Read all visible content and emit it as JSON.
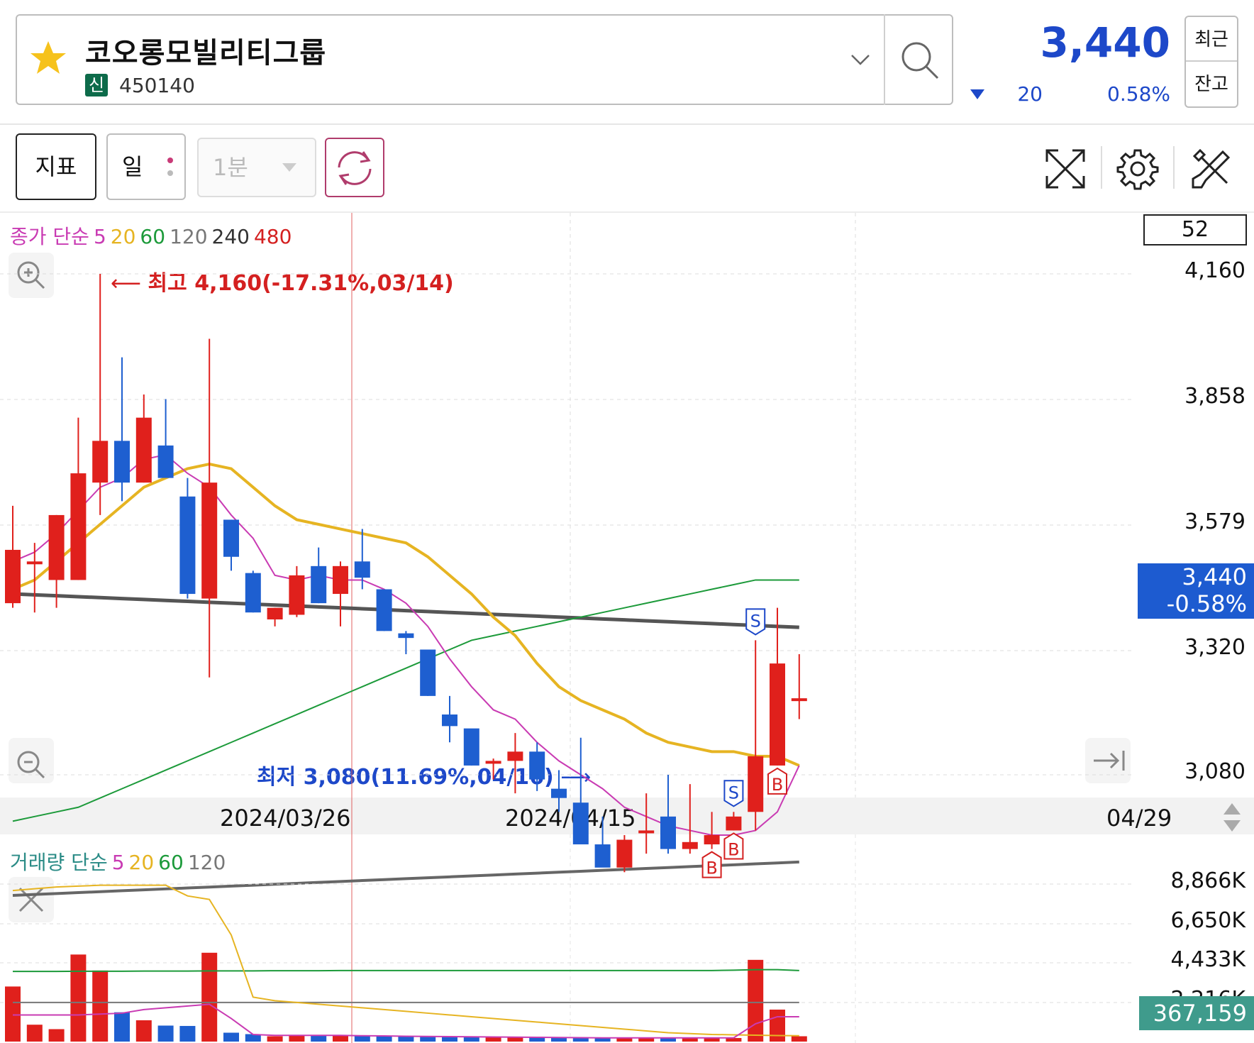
{
  "stock": {
    "name": "코오롱모빌리티그룹",
    "badge": "신",
    "code": "450140",
    "price": "3,440",
    "change": "20",
    "change_pct": "0.58%",
    "recent_label": "최근",
    "balance_label": "잔고"
  },
  "toolbar": {
    "indicator_label": "지표",
    "period_label": "일",
    "interval_label": "1분"
  },
  "price_chart": {
    "legend": {
      "prefix": "종가 단순",
      "ma5": "5",
      "ma20": "20",
      "ma60": "60",
      "ma120": "120",
      "ma240": "240",
      "ma480": "480"
    },
    "count_box": "52",
    "y_ticks": [
      "4,160",
      "3,858",
      "3,579",
      "3,320",
      "3,080"
    ],
    "current_price": "3,440",
    "current_pct": "-0.58%",
    "high_annotation": "최고 4,160(-17.31%,03/14)",
    "low_annotation": "최저 3,080(11.69%,04/16)",
    "x_ticks": [
      "2024/03/26",
      "2024/04/15",
      "04/29"
    ]
  },
  "volume_chart": {
    "legend": {
      "prefix": "거래량 단순",
      "ma5": "5",
      "ma20": "20",
      "ma60": "60",
      "ma120": "120"
    },
    "y_ticks": [
      "8,866K",
      "6,650K",
      "4,433K",
      "2,216K"
    ],
    "current_volume": "367,159"
  },
  "colors": {
    "up": "#e0201c",
    "down": "#1e5fd0",
    "ma5": "#c93bb3",
    "ma20": "#e6b422",
    "ma60": "#1c9a3a",
    "ma120": "#666666",
    "accent": "#1d48c9"
  },
  "chart_data": {
    "type": "candlestick",
    "candles": [
      {
        "o": 3450,
        "h": 3660,
        "l": 3440,
        "c": 3565
      },
      {
        "o": 3540,
        "h": 3580,
        "l": 3430,
        "c": 3540
      },
      {
        "o": 3500,
        "h": 3640,
        "l": 3440,
        "c": 3640
      },
      {
        "o": 3500,
        "h": 3850,
        "l": 3500,
        "c": 3730
      },
      {
        "o": 3710,
        "h": 4160,
        "l": 3640,
        "c": 3800
      },
      {
        "o": 3800,
        "h": 3980,
        "l": 3670,
        "c": 3710
      },
      {
        "o": 3710,
        "h": 3900,
        "l": 3710,
        "c": 3850
      },
      {
        "o": 3790,
        "h": 3890,
        "l": 3740,
        "c": 3720
      },
      {
        "o": 3680,
        "h": 3720,
        "l": 3460,
        "c": 3470
      },
      {
        "o": 3460,
        "h": 4020,
        "l": 3290,
        "c": 3710
      },
      {
        "o": 3630,
        "h": 3630,
        "l": 3520,
        "c": 3550
      },
      {
        "o": 3515,
        "h": 3520,
        "l": 3430,
        "c": 3430
      },
      {
        "o": 3415,
        "h": 3440,
        "l": 3400,
        "c": 3440
      },
      {
        "o": 3425,
        "h": 3530,
        "l": 3420,
        "c": 3510
      },
      {
        "o": 3530,
        "h": 3570,
        "l": 3450,
        "c": 3450
      },
      {
        "o": 3470,
        "h": 3540,
        "l": 3400,
        "c": 3530
      },
      {
        "o": 3540,
        "h": 3610,
        "l": 3480,
        "c": 3505
      },
      {
        "o": 3480,
        "h": 3480,
        "l": 3390,
        "c": 3390
      },
      {
        "o": 3385,
        "h": 3390,
        "l": 3340,
        "c": 3375
      },
      {
        "o": 3350,
        "h": 3350,
        "l": 3250,
        "c": 3250
      },
      {
        "o": 3210,
        "h": 3250,
        "l": 3150,
        "c": 3185
      },
      {
        "o": 3180,
        "h": 3175,
        "l": 3100,
        "c": 3100
      },
      {
        "o": 3110,
        "h": 3115,
        "l": 3070,
        "c": 3110
      },
      {
        "o": 3110,
        "h": 3170,
        "l": 3040,
        "c": 3130
      },
      {
        "o": 3130,
        "h": 3150,
        "l": 3045,
        "c": 3070
      },
      {
        "o": 3050,
        "h": 3090,
        "l": 3000,
        "c": 3030
      },
      {
        "o": 3020,
        "h": 3160,
        "l": 2980,
        "c": 2930
      },
      {
        "o": 2930,
        "h": 2990,
        "l": 2890,
        "c": 2880
      },
      {
        "o": 2880,
        "h": 2950,
        "l": 2870,
        "c": 2940
      },
      {
        "o": 2960,
        "h": 3040,
        "l": 2910,
        "c": 2960
      },
      {
        "o": 2990,
        "h": 3080,
        "l": 2910,
        "c": 2920
      },
      {
        "o": 2920,
        "h": 3060,
        "l": 2910,
        "c": 2935
      },
      {
        "o": 2930,
        "h": 3000,
        "l": 2920,
        "c": 2950
      },
      {
        "o": 2960,
        "h": 3000,
        "l": 2960,
        "c": 2990
      },
      {
        "o": 3000,
        "h": 3370,
        "l": 2960,
        "c": 3120
      },
      {
        "o": 3100,
        "h": 3440,
        "l": 3100,
        "c": 3320
      },
      {
        "o": 3245,
        "h": 3340,
        "l": 3200,
        "c": 3245
      }
    ],
    "ma_lines": {
      "ma5": [
        3540,
        3560,
        3600,
        3650,
        3700,
        3720,
        3760,
        3770,
        3730,
        3700,
        3640,
        3590,
        3510,
        3500,
        3510,
        3500,
        3500,
        3480,
        3450,
        3400,
        3330,
        3270,
        3220,
        3200,
        3150,
        3110,
        3080,
        3050,
        3010,
        2990,
        2970,
        2960,
        2950,
        2950,
        2960,
        3000,
        3100
      ],
      "ma20": [
        3480,
        3500,
        3540,
        3580,
        3620,
        3660,
        3700,
        3720,
        3740,
        3750,
        3740,
        3700,
        3660,
        3630,
        3620,
        3610,
        3600,
        3590,
        3580,
        3550,
        3510,
        3470,
        3420,
        3380,
        3320,
        3270,
        3240,
        3220,
        3200,
        3170,
        3150,
        3140,
        3130,
        3130,
        3120,
        3120,
        3100
      ],
      "ma60": [
        2980,
        2990,
        3000,
        3010,
        3030,
        3050,
        3070,
        3090,
        3110,
        3130,
        3150,
        3170,
        3190,
        3210,
        3230,
        3250,
        3270,
        3290,
        3310,
        3330,
        3350,
        3370,
        3380,
        3390,
        3400,
        3410,
        3420,
        3430,
        3440,
        3450,
        3460,
        3470,
        3480,
        3490,
        3500,
        3500,
        3500
      ],
      "ma120": [
        3470,
        3468,
        3466,
        3464,
        3462,
        3460,
        3458,
        3456,
        3454,
        3452,
        3450,
        3448,
        3446,
        3444,
        3442,
        3440,
        3438,
        3436,
        3434,
        3432,
        3430,
        3428,
        3426,
        3424,
        3422,
        3420,
        3418,
        3416,
        3414,
        3412,
        3410,
        3408,
        3406,
        3404,
        3402,
        3400,
        3398
      ],
      "ma240": [
        2820,
        2822,
        2824,
        2826,
        2828,
        2830,
        2832,
        2834,
        2836,
        2838,
        2840,
        2842,
        2844,
        2846,
        2848,
        2850,
        2852,
        2854,
        2856,
        2858,
        2860,
        2862,
        2864,
        2866,
        2868,
        2870,
        2872,
        2874,
        2876,
        2878,
        2880,
        2882,
        2884,
        2886,
        2888,
        2890,
        2892
      ]
    },
    "volume": [
      3100,
      950,
      700,
      4900,
      4000,
      1650,
      1200,
      900,
      880,
      5000,
      500,
      420,
      300,
      350,
      380,
      320,
      310,
      300,
      300,
      280,
      260,
      260,
      240,
      250,
      230,
      220,
      210,
      200,
      210,
      220,
      200,
      210,
      200,
      200,
      4600,
      1800,
      300
    ],
    "volume_ma": {
      "ma5": [
        1500,
        1500,
        1500,
        1500,
        1550,
        1600,
        1800,
        1900,
        2000,
        2100,
        1300,
        400,
        350,
        350,
        350,
        350,
        330,
        320,
        300,
        290,
        280,
        270,
        260,
        250,
        240,
        230,
        220,
        210,
        210,
        210,
        210,
        210,
        210,
        210,
        1000,
        1400,
        1400
      ],
      "ma20": [
        8500,
        8600,
        8700,
        8750,
        8800,
        8800,
        8800,
        8800,
        8200,
        8000,
        6000,
        2500,
        2300,
        2200,
        2100,
        2000,
        1900,
        1800,
        1700,
        1600,
        1500,
        1400,
        1300,
        1200,
        1100,
        1000,
        900,
        800,
        700,
        600,
        500,
        450,
        400,
        380,
        360,
        340,
        330
      ],
      "ma60": [
        3950,
        3950,
        3950,
        3960,
        3960,
        3960,
        3970,
        3970,
        3970,
        3980,
        3980,
        3980,
        3990,
        3990,
        3990,
        4000,
        4000,
        4000,
        4000,
        4000,
        4000,
        4000,
        4000,
        4000,
        4000,
        4000,
        4000,
        4000,
        4000,
        4000,
        4000,
        4000,
        4000,
        4020,
        4050,
        4050,
        4000
      ],
      "ma120": [
        2200,
        2200,
        2200,
        2200,
        2200,
        2200,
        2200,
        2200,
        2200,
        2200,
        2200,
        2200,
        2200,
        2200,
        2200,
        2200,
        2200,
        2200,
        2200,
        2200,
        2200,
        2200,
        2200,
        2200,
        2200,
        2200,
        2200,
        2200,
        2200,
        2200,
        2200,
        2200,
        2200,
        2200,
        2200,
        2200,
        2200
      ]
    },
    "signals": [
      {
        "i": 33,
        "type": "B"
      },
      {
        "i": 32,
        "type": "B"
      },
      {
        "i": 33,
        "type": "S"
      },
      {
        "i": 34,
        "type": "S"
      },
      {
        "i": 35,
        "type": "B"
      }
    ]
  }
}
